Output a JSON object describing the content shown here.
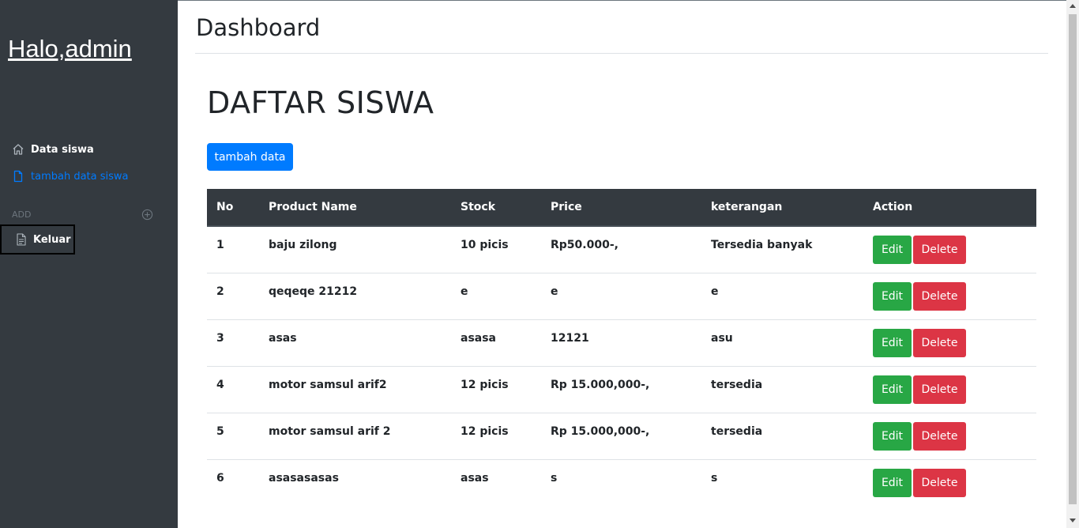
{
  "sidebar": {
    "brand": "Halo,admin",
    "items": [
      {
        "label": "Data siswa",
        "icon": "home-icon"
      },
      {
        "label": "tambah data siswa",
        "icon": "file-icon"
      }
    ],
    "add_heading": "ADD",
    "add_icon": "plus-circle-icon",
    "logout": {
      "label": "Keluar",
      "icon": "file-text-icon"
    }
  },
  "header": {
    "title": "Dashboard"
  },
  "main": {
    "heading": "DAFTAR SISWA",
    "add_button": "tambah data",
    "table": {
      "columns": [
        "No",
        "Product Name",
        "Stock",
        "Price",
        "keterangan",
        "Action"
      ],
      "rows": [
        [
          "1",
          "baju zilong",
          "10 picis",
          "Rp50.000-,",
          "Tersedia banyak"
        ],
        [
          "2",
          "qeqeqe 21212",
          "e",
          "e",
          "e"
        ],
        [
          "3",
          "asas",
          "asasa",
          "12121",
          "asu"
        ],
        [
          "4",
          "motor samsul arif2",
          "12 picis",
          "Rp 15.000,000-,",
          "tersedia"
        ],
        [
          "5",
          "motor samsul arif 2",
          "12 picis",
          "Rp 15.000,000-,",
          "tersedia"
        ],
        [
          "6",
          "asasasasas",
          "asas",
          "s",
          "s"
        ]
      ],
      "edit_label": "Edit",
      "delete_label": "Delete"
    }
  },
  "colors": {
    "sidebar_bg": "#343a40",
    "primary": "#007bff",
    "success": "#28a745",
    "danger": "#dc3545",
    "table_head_bg": "#343a40"
  }
}
